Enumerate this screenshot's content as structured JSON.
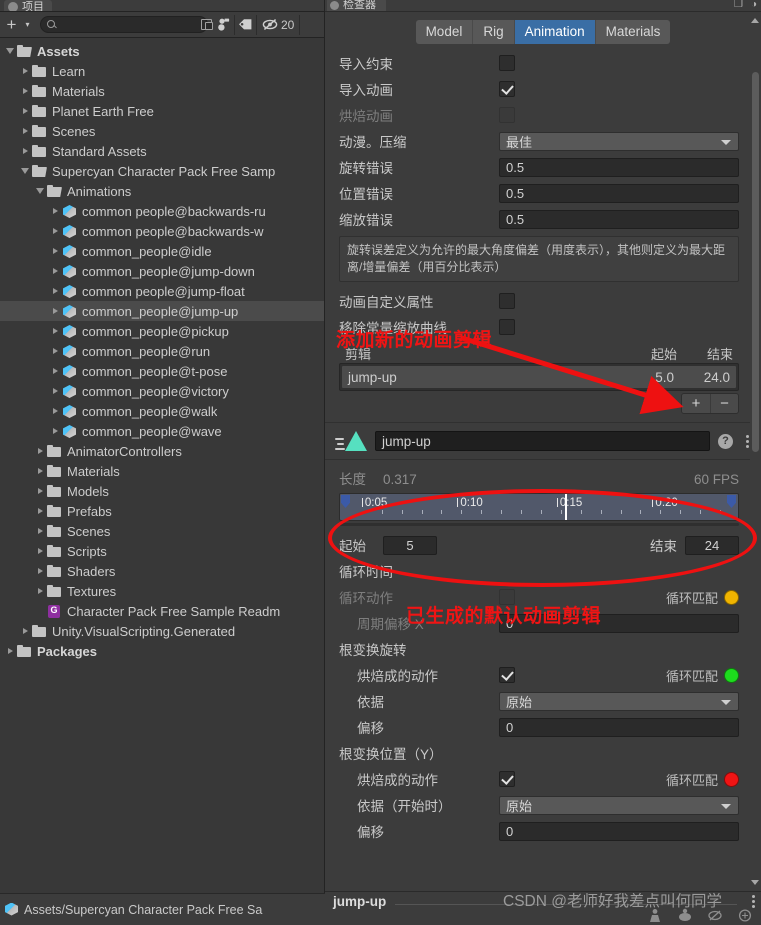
{
  "project": {
    "tab_label": "项目",
    "toolbar": {
      "add_label": "+",
      "caret_label": "▾",
      "search_placeholder": "",
      "search_value": "",
      "search_icon": "search-icon",
      "popout_icon": "popout-icon",
      "favorites_icon": "favorites-icon",
      "label_icon": "label-tag-icon",
      "hidden_icon": "hidden-eye-icon",
      "hidden_count": "20"
    },
    "tree": [
      {
        "label": "Assets",
        "depth": 0,
        "icon": "folder-open",
        "state": "open",
        "bold": true,
        "selected": false
      },
      {
        "label": "Learn",
        "depth": 1,
        "icon": "folder",
        "state": "closed",
        "bold": false,
        "selected": false
      },
      {
        "label": "Materials",
        "depth": 1,
        "icon": "folder",
        "state": "closed",
        "bold": false,
        "selected": false
      },
      {
        "label": "Planet Earth Free",
        "depth": 1,
        "icon": "folder",
        "state": "closed",
        "bold": false,
        "selected": false
      },
      {
        "label": "Scenes",
        "depth": 1,
        "icon": "folder",
        "state": "closed",
        "bold": false,
        "selected": false
      },
      {
        "label": "Standard Assets",
        "depth": 1,
        "icon": "folder",
        "state": "closed",
        "bold": false,
        "selected": false
      },
      {
        "label": "Supercyan Character Pack Free Samp",
        "depth": 1,
        "icon": "folder-open",
        "state": "open",
        "bold": false,
        "selected": false
      },
      {
        "label": "Animations",
        "depth": 2,
        "icon": "folder-open",
        "state": "open",
        "bold": false,
        "selected": false
      },
      {
        "label": "common people@backwards-ru",
        "depth": 3,
        "icon": "model",
        "state": "closed",
        "bold": false,
        "selected": false
      },
      {
        "label": "common people@backwards-w",
        "depth": 3,
        "icon": "model",
        "state": "closed",
        "bold": false,
        "selected": false
      },
      {
        "label": "common_people@idle",
        "depth": 3,
        "icon": "model",
        "state": "closed",
        "bold": false,
        "selected": false
      },
      {
        "label": "common_people@jump-down",
        "depth": 3,
        "icon": "model",
        "state": "closed",
        "bold": false,
        "selected": false
      },
      {
        "label": "common people@jump-float",
        "depth": 3,
        "icon": "model",
        "state": "closed",
        "bold": false,
        "selected": false
      },
      {
        "label": "common_people@jump-up",
        "depth": 3,
        "icon": "model",
        "state": "closed",
        "bold": false,
        "selected": true
      },
      {
        "label": "common_people@pickup",
        "depth": 3,
        "icon": "model",
        "state": "closed",
        "bold": false,
        "selected": false
      },
      {
        "label": "common_people@run",
        "depth": 3,
        "icon": "model",
        "state": "closed",
        "bold": false,
        "selected": false
      },
      {
        "label": "common_people@t-pose",
        "depth": 3,
        "icon": "model",
        "state": "closed",
        "bold": false,
        "selected": false
      },
      {
        "label": "common_people@victory",
        "depth": 3,
        "icon": "model",
        "state": "closed",
        "bold": false,
        "selected": false
      },
      {
        "label": "common_people@walk",
        "depth": 3,
        "icon": "model",
        "state": "closed",
        "bold": false,
        "selected": false
      },
      {
        "label": "common_people@wave",
        "depth": 3,
        "icon": "model",
        "state": "closed",
        "bold": false,
        "selected": false
      },
      {
        "label": "AnimatorControllers",
        "depth": 2,
        "icon": "folder",
        "state": "closed",
        "bold": false,
        "selected": false
      },
      {
        "label": "Materials",
        "depth": 2,
        "icon": "folder",
        "state": "closed",
        "bold": false,
        "selected": false
      },
      {
        "label": "Models",
        "depth": 2,
        "icon": "folder",
        "state": "closed",
        "bold": false,
        "selected": false
      },
      {
        "label": "Prefabs",
        "depth": 2,
        "icon": "folder",
        "state": "closed",
        "bold": false,
        "selected": false
      },
      {
        "label": "Scenes",
        "depth": 2,
        "icon": "folder",
        "state": "closed",
        "bold": false,
        "selected": false
      },
      {
        "label": "Scripts",
        "depth": 2,
        "icon": "folder",
        "state": "closed",
        "bold": false,
        "selected": false
      },
      {
        "label": "Shaders",
        "depth": 2,
        "icon": "folder",
        "state": "closed",
        "bold": false,
        "selected": false
      },
      {
        "label": "Textures",
        "depth": 2,
        "icon": "folder",
        "state": "closed",
        "bold": false,
        "selected": false
      },
      {
        "label": "Character Pack Free Sample Readm",
        "depth": 2,
        "icon": "pdf",
        "state": "none",
        "bold": false,
        "selected": false
      },
      {
        "label": "Unity.VisualScripting.Generated",
        "depth": 1,
        "icon": "folder",
        "state": "closed",
        "bold": false,
        "selected": false
      },
      {
        "label": "Packages",
        "depth": 0,
        "icon": "folder",
        "state": "closed",
        "bold": true,
        "selected": false
      }
    ],
    "breadcrumb": "Assets/Supercyan Character Pack Free Sa"
  },
  "inspector": {
    "tab_label": "检查器",
    "importer_tabs": [
      {
        "label": "Model",
        "active": false
      },
      {
        "label": "Rig",
        "active": false
      },
      {
        "label": "Animation",
        "active": true
      },
      {
        "label": "Materials",
        "active": false
      }
    ],
    "fields": [
      {
        "label": "导入约束",
        "type": "checkbox",
        "checked": false,
        "dim": false
      },
      {
        "label": "导入动画",
        "type": "checkbox",
        "checked": true,
        "dim": false
      },
      {
        "label": "烘焙动画",
        "type": "checkbox",
        "checked": false,
        "dim": true
      },
      {
        "label": "动漫。压缩",
        "type": "dropdown",
        "value": "最佳",
        "dim": false
      },
      {
        "label": "旋转错误",
        "type": "number",
        "value": "0.5",
        "dim": false
      },
      {
        "label": "位置错误",
        "type": "number",
        "value": "0.5",
        "dim": false
      },
      {
        "label": "缩放错误",
        "type": "number",
        "value": "0.5",
        "dim": false
      }
    ],
    "helpbox": "旋转误差定义为允许的最大角度偏差（用度表示），其他则定义为最大距离/增量偏差（用百分比表示）",
    "fields2": [
      {
        "label": "动画自定义属性",
        "type": "checkbox",
        "checked": false,
        "dim": false
      },
      {
        "label": "移除常量缩放曲线",
        "type": "checkbox",
        "checked": false,
        "dim": false
      }
    ],
    "clip_table": {
      "header": {
        "name": "剪辑",
        "start": "起始",
        "end": "结束"
      },
      "rows": [
        {
          "name": "jump-up",
          "start": "5.0",
          "end": "24.0",
          "selected": true
        }
      ],
      "add_label": "+",
      "remove_label": "−"
    },
    "clip_editor": {
      "icon": "animation-clip-icon",
      "clip_name": "jump-up",
      "help_label": "?",
      "menu_icon": "kebab-menu-icon",
      "length_label": "长度",
      "length_value": "0.317",
      "fps_label": "60 FPS",
      "timeline_ticks": [
        "0:05",
        "0:10",
        "0:15",
        "0:20"
      ],
      "start_label": "起始",
      "start_value": "5",
      "end_label": "结束",
      "end_value": "24"
    },
    "loop_section": {
      "title": "循环时间",
      "loop_pose_label": "循环动作",
      "loop_pose_checked": false,
      "loop_pose_match_label": "循环匹配",
      "loop_pose_match_color": "#f0b400",
      "cycle_offset_label": "周期偏移 X",
      "cycle_offset_value": "0"
    },
    "root_rotation": {
      "title": "根变换旋转",
      "bake_label": "烘焙成的动作",
      "bake_checked": true,
      "match_label": "循环匹配",
      "match_color": "#1ddc1d",
      "based_label": "依据",
      "based_value": "原始",
      "offset_label": "偏移",
      "offset_value": "0"
    },
    "root_position_y": {
      "title": "根变换位置（Y）",
      "bake_label": "烘焙成的动作",
      "bake_checked": true,
      "match_label": "循环匹配",
      "match_color": "#f01414",
      "based_label": "依据（开始时）",
      "based_value": "原始",
      "offset_label": "偏移",
      "offset_value": "0"
    },
    "bottom": {
      "title": "jump-up",
      "menu_icon": "kebab-menu-icon",
      "preview_icons": [
        "avatar-icon",
        "ik-icon",
        "pivot-icon",
        "settings-icon"
      ]
    }
  },
  "annotations": [
    {
      "text": "添加新的动画剪辑",
      "color": "#f01414"
    },
    {
      "text": "已生成的默认动画剪辑",
      "color": "#f01414"
    }
  ],
  "watermark": "CSDN @老师好我差点叫何同学"
}
